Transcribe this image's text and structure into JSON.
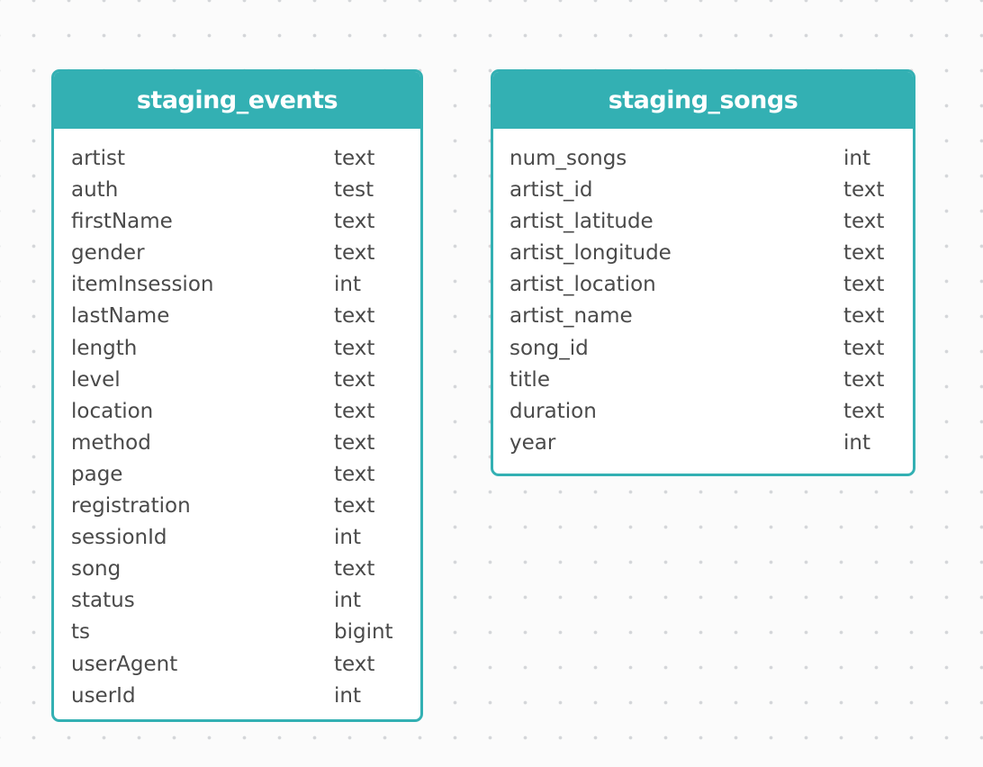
{
  "tables": [
    {
      "name": "staging_events",
      "columns": [
        {
          "name": "artist",
          "type": "text"
        },
        {
          "name": "auth",
          "type": "test"
        },
        {
          "name": "firstName",
          "type": "text"
        },
        {
          "name": "gender",
          "type": "text"
        },
        {
          "name": "itemInsession",
          "type": "int"
        },
        {
          "name": "lastName",
          "type": "text"
        },
        {
          "name": "length",
          "type": "text"
        },
        {
          "name": "level",
          "type": "text"
        },
        {
          "name": "location",
          "type": "text"
        },
        {
          "name": "method",
          "type": "text"
        },
        {
          "name": "page",
          "type": "text"
        },
        {
          "name": "registration",
          "type": "text"
        },
        {
          "name": "sessionId",
          "type": "int"
        },
        {
          "name": "song",
          "type": "text"
        },
        {
          "name": "status",
          "type": "int"
        },
        {
          "name": "ts",
          "type": "bigint"
        },
        {
          "name": "userAgent",
          "type": "text"
        },
        {
          "name": "userId",
          "type": "int"
        }
      ]
    },
    {
      "name": "staging_songs",
      "columns": [
        {
          "name": "num_songs",
          "type": "int"
        },
        {
          "name": "artist_id",
          "type": "text"
        },
        {
          "name": "artist_latitude",
          "type": "text"
        },
        {
          "name": "artist_longitude",
          "type": "text"
        },
        {
          "name": "artist_location",
          "type": "text"
        },
        {
          "name": "artist_name",
          "type": "text"
        },
        {
          "name": "song_id",
          "type": "text"
        },
        {
          "name": "title",
          "type": "text"
        },
        {
          "name": "duration",
          "type": "text"
        },
        {
          "name": "year",
          "type": "int"
        }
      ]
    }
  ],
  "colors": {
    "header_bg": "#33b0b3",
    "header_text": "#ffffff",
    "body_text": "#4a4a4a",
    "canvas_bg": "#fbfbfb",
    "grid_dot": "#d4d6d9"
  }
}
